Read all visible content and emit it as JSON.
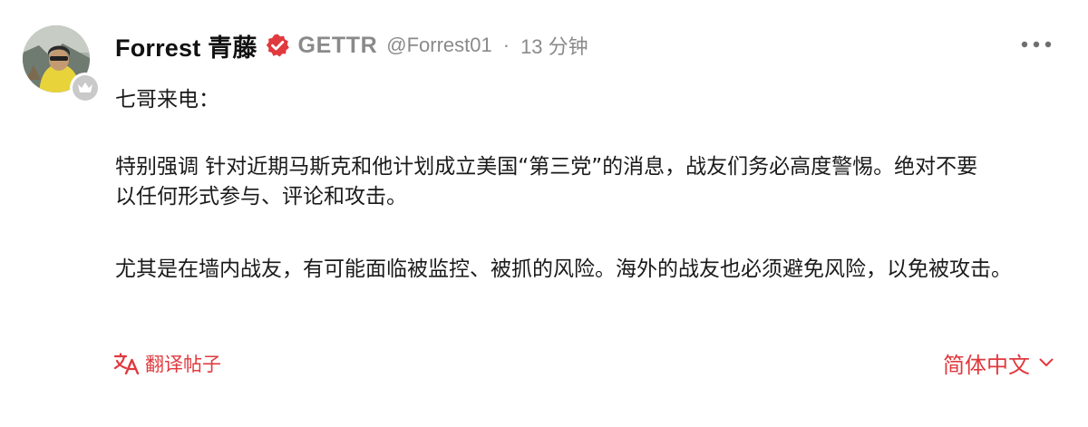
{
  "post": {
    "author": {
      "display_name": "Forrest 青藤",
      "platform": "GETTR",
      "handle": "@Forrest01",
      "separator": "·",
      "time": "13 分钟"
    },
    "content": {
      "paragraphs": [
        "七哥来电：",
        "特别强调 针对近期马斯克和他计划成立美国“第三党”的消息，战友们务必高度警惕。绝对不要以任何形式参与、评论和攻击。",
        "尤其是在墙内战友，有可能面临被监控、被抓的风险。海外的战友也必须避免风险，以免被攻击。"
      ]
    },
    "footer": {
      "translate_label": "翻译帖子",
      "language_label": "简体中文"
    }
  },
  "icons": {
    "verified": "verified-badge-icon",
    "more": "more-horizontal-icon",
    "translate": "translate-icon",
    "chevron": "chevron-down-icon",
    "rank": "crown-icon"
  },
  "colors": {
    "accent": "#e0393e",
    "muted": "#8a8a8a",
    "text": "#1a1a1a"
  }
}
